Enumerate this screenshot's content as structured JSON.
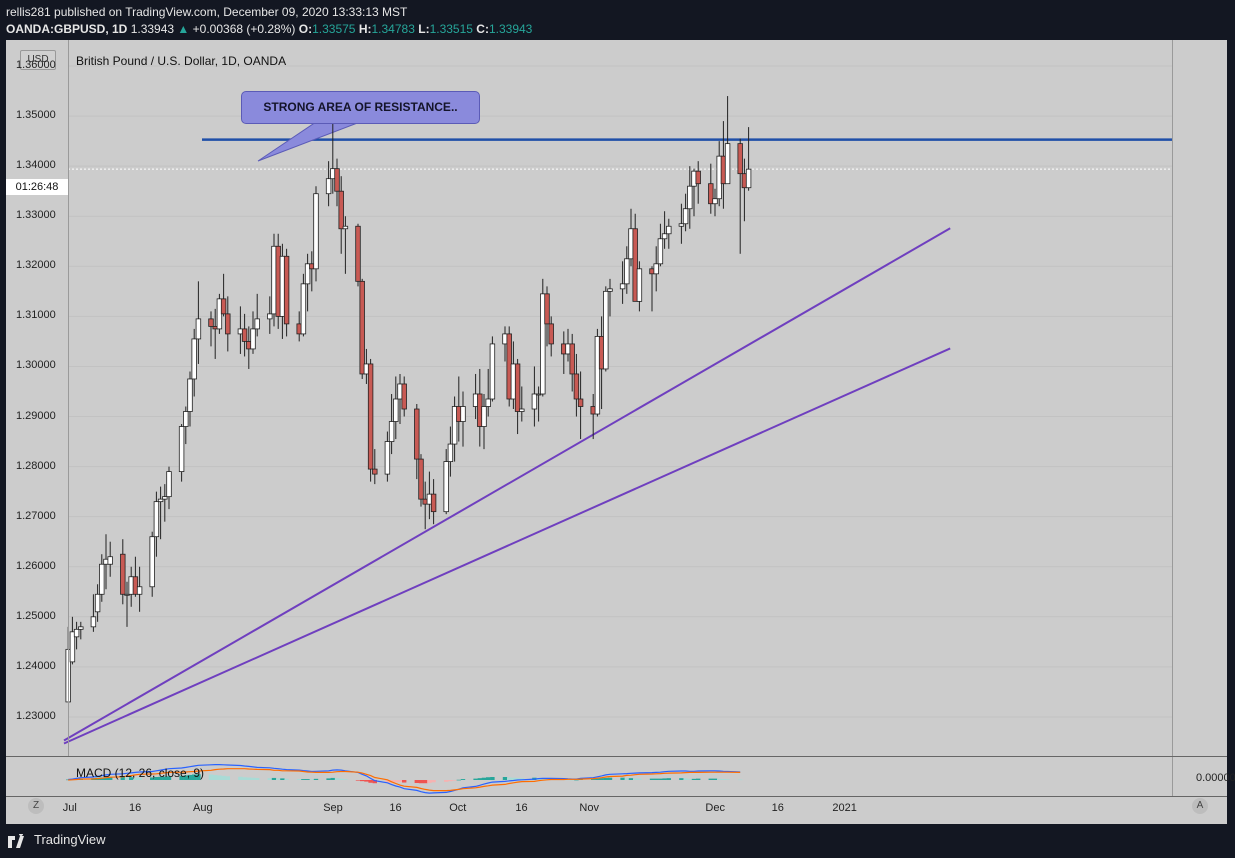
{
  "header": {
    "publisher_line": "rellis281 published on TradingView.com, December 09, 2020 13:33:13 MST",
    "symbol": "OANDA:GBPUSD, 1D",
    "last": "1.33943",
    "change": "+0.00368 (+0.28%)",
    "o_label": "O:",
    "o_value": "1.33575",
    "h_label": "H:",
    "h_value": "1.34783",
    "l_label": "L:",
    "l_value": "1.33515",
    "c_label": "C:",
    "c_value": "1.33943"
  },
  "chart_data": {
    "type": "candlestick",
    "title": "British Pound / U.S. Dollar, 1D, OANDA",
    "currency": "USD",
    "countdown": "01:26:48",
    "ylim": [
      1.223,
      1.364
    ],
    "y_ticks": [
      "1.36000",
      "1.35000",
      "1.34000",
      "1.33000",
      "1.32000",
      "1.31000",
      "1.30000",
      "1.29000",
      "1.28000",
      "1.27000",
      "1.26000",
      "1.25000",
      "1.24000",
      "1.23000"
    ],
    "x_ticks": [
      "Jul",
      "16",
      "Aug",
      "Sep",
      "16",
      "Oct",
      "16",
      "Nov",
      "Dec",
      "16",
      "2021"
    ],
    "annotation": "STRONG AREA OF RESISTANCE..",
    "resistance_level": 1.3453,
    "trendlines": [
      {
        "from": [
          "2020-06-29",
          1.2253
        ],
        "to": [
          "2021-01-26",
          1.3276
        ]
      },
      {
        "from": [
          "2020-06-29",
          1.2247
        ],
        "to": [
          "2021-01-26",
          1.3036
        ]
      }
    ],
    "candles": [
      [
        "2020-06-30",
        1.233,
        1.248,
        1.237,
        1.2435
      ],
      [
        "2020-07-01",
        1.241,
        1.25,
        1.2405,
        1.247
      ],
      [
        "2020-07-02",
        1.246,
        1.249,
        1.2435,
        1.2475
      ],
      [
        "2020-07-03",
        1.2475,
        1.249,
        1.2455,
        1.248
      ],
      [
        "2020-07-06",
        1.248,
        1.2545,
        1.247,
        1.25
      ],
      [
        "2020-07-07",
        1.251,
        1.2565,
        1.249,
        1.2545
      ],
      [
        "2020-07-08",
        1.2545,
        1.2625,
        1.253,
        1.2605
      ],
      [
        "2020-07-09",
        1.2605,
        1.2665,
        1.2555,
        1.2615
      ],
      [
        "2020-07-10",
        1.2605,
        1.265,
        1.258,
        1.262
      ],
      [
        "2020-07-13",
        1.2625,
        1.2655,
        1.2525,
        1.2545
      ],
      [
        "2020-07-14",
        1.2545,
        1.257,
        1.248,
        1.2545
      ],
      [
        "2020-07-15",
        1.2545,
        1.26,
        1.252,
        1.258
      ],
      [
        "2020-07-16",
        1.258,
        1.262,
        1.254,
        1.2545
      ],
      [
        "2020-07-17",
        1.2545,
        1.26,
        1.251,
        1.256
      ],
      [
        "2020-07-20",
        1.256,
        1.267,
        1.254,
        1.266
      ],
      [
        "2020-07-21",
        1.266,
        1.275,
        1.262,
        1.273
      ],
      [
        "2020-07-22",
        1.273,
        1.276,
        1.2655,
        1.2735
      ],
      [
        "2020-07-23",
        1.2735,
        1.2765,
        1.269,
        1.274
      ],
      [
        "2020-07-24",
        1.274,
        1.28,
        1.2715,
        1.279
      ],
      [
        "2020-07-27",
        1.279,
        1.2885,
        1.277,
        1.288
      ],
      [
        "2020-07-28",
        1.288,
        1.292,
        1.2845,
        1.291
      ],
      [
        "2020-07-29",
        1.291,
        1.299,
        1.288,
        1.2975
      ],
      [
        "2020-07-30",
        1.2975,
        1.3075,
        1.294,
        1.3055
      ],
      [
        "2020-07-31",
        1.3055,
        1.317,
        1.3005,
        1.3095
      ],
      [
        "2020-08-03",
        1.3095,
        1.311,
        1.304,
        1.308
      ],
      [
        "2020-08-04",
        1.308,
        1.3115,
        1.3015,
        1.3075
      ],
      [
        "2020-08-05",
        1.3075,
        1.3145,
        1.3065,
        1.3135
      ],
      [
        "2020-08-06",
        1.3135,
        1.3185,
        1.31,
        1.3105
      ],
      [
        "2020-08-07",
        1.3105,
        1.314,
        1.303,
        1.3065
      ],
      [
        "2020-08-10",
        1.3065,
        1.312,
        1.3025,
        1.3075
      ],
      [
        "2020-08-11",
        1.3075,
        1.3105,
        1.302,
        1.305
      ],
      [
        "2020-08-12",
        1.305,
        1.308,
        1.2995,
        1.3035
      ],
      [
        "2020-08-13",
        1.3035,
        1.311,
        1.3025,
        1.3075
      ],
      [
        "2020-08-14",
        1.3075,
        1.3145,
        1.306,
        1.3095
      ],
      [
        "2020-08-17",
        1.3095,
        1.314,
        1.3065,
        1.3105
      ],
      [
        "2020-08-18",
        1.3105,
        1.3265,
        1.308,
        1.324
      ],
      [
        "2020-08-19",
        1.324,
        1.3265,
        1.3075,
        1.31
      ],
      [
        "2020-08-20",
        1.31,
        1.3245,
        1.3055,
        1.322
      ],
      [
        "2020-08-21",
        1.322,
        1.3235,
        1.306,
        1.3085
      ],
      [
        "2020-08-24",
        1.3085,
        1.311,
        1.305,
        1.3065
      ],
      [
        "2020-08-25",
        1.3065,
        1.3185,
        1.306,
        1.3165
      ],
      [
        "2020-08-26",
        1.3165,
        1.3225,
        1.311,
        1.3205
      ],
      [
        "2020-08-27",
        1.3205,
        1.323,
        1.315,
        1.3195
      ],
      [
        "2020-08-28",
        1.3195,
        1.336,
        1.317,
        1.3345
      ],
      [
        "2020-08-31",
        1.3345,
        1.341,
        1.332,
        1.3375
      ],
      [
        "2020-09-01",
        1.3375,
        1.3485,
        1.3345,
        1.3395
      ],
      [
        "2020-09-02",
        1.3395,
        1.3415,
        1.332,
        1.335
      ],
      [
        "2020-09-03",
        1.335,
        1.338,
        1.3225,
        1.3275
      ],
      [
        "2020-09-04",
        1.3275,
        1.33,
        1.3185,
        1.328
      ],
      [
        "2020-09-07",
        1.328,
        1.3285,
        1.316,
        1.317
      ],
      [
        "2020-09-08",
        1.317,
        1.3175,
        1.2975,
        1.2985
      ],
      [
        "2020-09-09",
        1.2985,
        1.3035,
        1.2965,
        1.3005
      ],
      [
        "2020-09-10",
        1.3005,
        1.3015,
        1.277,
        1.2795
      ],
      [
        "2020-09-11",
        1.2795,
        1.2835,
        1.2765,
        1.2785
      ],
      [
        "2020-09-14",
        1.2785,
        1.287,
        1.277,
        1.285
      ],
      [
        "2020-09-15",
        1.285,
        1.2945,
        1.2825,
        1.289
      ],
      [
        "2020-09-16",
        1.289,
        1.298,
        1.2855,
        1.2935
      ],
      [
        "2020-09-17",
        1.2935,
        1.2985,
        1.2885,
        1.2965
      ],
      [
        "2020-09-18",
        1.2965,
        1.298,
        1.29,
        1.2915
      ],
      [
        "2020-09-21",
        1.2915,
        1.2925,
        1.2775,
        1.2815
      ],
      [
        "2020-09-22",
        1.2815,
        1.2825,
        1.272,
        1.2735
      ],
      [
        "2020-09-23",
        1.2735,
        1.277,
        1.2675,
        1.2725
      ],
      [
        "2020-09-24",
        1.2725,
        1.279,
        1.2695,
        1.2745
      ],
      [
        "2020-09-25",
        1.2745,
        1.2775,
        1.2685,
        1.271
      ],
      [
        "2020-09-28",
        1.271,
        1.2835,
        1.2705,
        1.281
      ],
      [
        "2020-09-29",
        1.281,
        1.288,
        1.278,
        1.2845
      ],
      [
        "2020-09-30",
        1.2845,
        1.294,
        1.281,
        1.292
      ],
      [
        "2020-10-01",
        1.292,
        1.298,
        1.285,
        1.289
      ],
      [
        "2020-10-02",
        1.289,
        1.295,
        1.284,
        1.292
      ],
      [
        "2020-10-05",
        1.292,
        1.2985,
        1.2895,
        1.2945
      ],
      [
        "2020-10-06",
        1.2945,
        1.2995,
        1.284,
        1.288
      ],
      [
        "2020-10-07",
        1.288,
        1.2945,
        1.2835,
        1.292
      ],
      [
        "2020-10-08",
        1.292,
        1.2995,
        1.29,
        1.2935
      ],
      [
        "2020-10-09",
        1.2935,
        1.306,
        1.293,
        1.3045
      ],
      [
        "2020-10-12",
        1.3045,
        1.308,
        1.301,
        1.3065
      ],
      [
        "2020-10-13",
        1.3065,
        1.308,
        1.292,
        1.2935
      ],
      [
        "2020-10-14",
        1.2935,
        1.305,
        1.2915,
        1.3005
      ],
      [
        "2020-10-15",
        1.3005,
        1.3015,
        1.2865,
        1.291
      ],
      [
        "2020-10-16",
        1.291,
        1.296,
        1.289,
        1.2915
      ],
      [
        "2020-10-19",
        1.2915,
        1.3,
        1.288,
        1.2945
      ],
      [
        "2020-10-20",
        1.2945,
        1.296,
        1.289,
        1.2945
      ],
      [
        "2020-10-21",
        1.2945,
        1.3175,
        1.294,
        1.3145
      ],
      [
        "2020-10-22",
        1.3145,
        1.316,
        1.304,
        1.3085
      ],
      [
        "2020-10-23",
        1.3085,
        1.31,
        1.302,
        1.3045
      ],
      [
        "2020-10-26",
        1.3045,
        1.307,
        1.2985,
        1.3025
      ],
      [
        "2020-10-27",
        1.3025,
        1.3075,
        1.301,
        1.3045
      ],
      [
        "2020-10-28",
        1.3045,
        1.3065,
        1.295,
        1.2985
      ],
      [
        "2020-10-29",
        1.2985,
        1.3025,
        1.29,
        1.2935
      ],
      [
        "2020-10-30",
        1.2935,
        1.299,
        1.2855,
        1.292
      ],
      [
        "2020-11-02",
        1.292,
        1.2945,
        1.2855,
        1.2905
      ],
      [
        "2020-11-03",
        1.2905,
        1.3075,
        1.29,
        1.306
      ],
      [
        "2020-11-04",
        1.306,
        1.31,
        1.2915,
        1.2995
      ],
      [
        "2020-11-05",
        1.2995,
        1.316,
        1.299,
        1.315
      ],
      [
        "2020-11-06",
        1.315,
        1.3175,
        1.31,
        1.3155
      ],
      [
        "2020-11-09",
        1.3155,
        1.321,
        1.3125,
        1.3165
      ],
      [
        "2020-11-10",
        1.3165,
        1.324,
        1.3145,
        1.3215
      ],
      [
        "2020-11-11",
        1.3215,
        1.3315,
        1.32,
        1.3275
      ],
      [
        "2020-11-12",
        1.3275,
        1.3305,
        1.313,
        1.313
      ],
      [
        "2020-11-13",
        1.313,
        1.321,
        1.311,
        1.3195
      ],
      [
        "2020-11-16",
        1.3195,
        1.32,
        1.311,
        1.3185
      ],
      [
        "2020-11-17",
        1.3185,
        1.324,
        1.315,
        1.3205
      ],
      [
        "2020-11-18",
        1.3205,
        1.3285,
        1.32,
        1.3255
      ],
      [
        "2020-11-19",
        1.3255,
        1.331,
        1.3235,
        1.3265
      ],
      [
        "2020-11-20",
        1.3265,
        1.3295,
        1.3235,
        1.328
      ],
      [
        "2020-11-23",
        1.328,
        1.3325,
        1.3245,
        1.3285
      ],
      [
        "2020-11-24",
        1.3285,
        1.3345,
        1.327,
        1.3315
      ],
      [
        "2020-11-25",
        1.3315,
        1.34,
        1.3275,
        1.336
      ],
      [
        "2020-11-26",
        1.336,
        1.3395,
        1.33,
        1.339
      ],
      [
        "2020-11-27",
        1.339,
        1.341,
        1.3325,
        1.3365
      ],
      [
        "2020-11-30",
        1.3365,
        1.3405,
        1.3305,
        1.3325
      ],
      [
        "2020-12-01",
        1.3325,
        1.3355,
        1.33,
        1.3335
      ],
      [
        "2020-12-02",
        1.3335,
        1.345,
        1.332,
        1.342
      ],
      [
        "2020-12-03",
        1.342,
        1.349,
        1.3315,
        1.3365
      ],
      [
        "2020-12-04",
        1.3365,
        1.354,
        1.3365,
        1.3445
      ],
      [
        "2020-12-07",
        1.3445,
        1.3455,
        1.3225,
        1.3385
      ],
      [
        "2020-12-08",
        1.3385,
        1.3415,
        1.329,
        1.3357
      ],
      [
        "2020-12-09",
        1.3357,
        1.3478,
        1.3351,
        1.3394
      ]
    ],
    "macd": {
      "label": "MACD (12, 26, close, 9)",
      "zero_label": "0.00000",
      "histogram": [
        0.2,
        0.4,
        0.5,
        0.6,
        0.8,
        1.0,
        1.1,
        1.2,
        1.3,
        1.3,
        1.2,
        1.2,
        1.1,
        1.0,
        1.1,
        1.3,
        1.4,
        1.5,
        1.6,
        1.8,
        2.0,
        2.2,
        2.4,
        2.5,
        2.4,
        2.2,
        2.0,
        1.8,
        1.6,
        1.4,
        1.2,
        1.1,
        1.0,
        0.9,
        0.8,
        0.9,
        0.7,
        0.7,
        0.5,
        0.4,
        0.4,
        0.4,
        0.3,
        0.5,
        0.7,
        0.9,
        0.8,
        0.6,
        0.3,
        -0.1,
        -0.5,
        -0.7,
        -1.2,
        -1.4,
        -1.3,
        -1.2,
        -1.1,
        -0.9,
        -1.1,
        -1.3,
        -1.4,
        -1.4,
        -1.3,
        -1.0,
        -0.8,
        -0.5,
        -0.2,
        0.1,
        0.4,
        0.6,
        0.8,
        1.0,
        1.2,
        1.3,
        1.3,
        1.1,
        1.0,
        0.9,
        0.8,
        1.0,
        0.9,
        0.8,
        0.6,
        0.5,
        0.4,
        0.2,
        0.1,
        0.1,
        0.3,
        0.4,
        0.6,
        0.8,
        0.9,
        1.0,
        1.0,
        0.8,
        0.8,
        0.7,
        0.6,
        0.6,
        0.6,
        0.6,
        0.7,
        0.8,
        0.8,
        0.7,
        0.5,
        0.5,
        0.6,
        0.6,
        0.6,
        0.5,
        0.4,
        0.3,
        0.2
      ],
      "macd_line": [
        0.2,
        0.4,
        0.7,
        1.0,
        1.3,
        1.6,
        1.9,
        2.2,
        2.5,
        2.7,
        2.9,
        3.1,
        3.3,
        3.5,
        3.7,
        4.0,
        4.3,
        4.6,
        4.9,
        5.2,
        5.5,
        5.8,
        6.1,
        6.4,
        6.6,
        6.7,
        6.7,
        6.6,
        6.5,
        6.3,
        6.1,
        5.9,
        5.7,
        5.5,
        5.3,
        5.1,
        4.9,
        4.7,
        4.5,
        4.3,
        4.1,
        3.9,
        3.7,
        3.8,
        4.0,
        4.3,
        4.4,
        4.3,
        4.0,
        3.3,
        2.5,
        1.8,
        0.7,
        -0.3,
        -1.2,
        -2.0,
        -2.6,
        -3.1,
        -3.8,
        -4.5,
        -5.1,
        -5.5,
        -5.7,
        -5.6,
        -5.4,
        -5.0,
        -4.5,
        -4.0,
        -3.4,
        -2.8,
        -2.3,
        -1.8,
        -1.3,
        -0.9,
        -0.6,
        -0.4,
        -0.2,
        0.0,
        0.1,
        0.4,
        0.6,
        0.7,
        0.7,
        0.7,
        0.6,
        0.5,
        0.4,
        0.4,
        0.7,
        1.0,
        1.4,
        1.8,
        2.2,
        2.5,
        2.7,
        2.8,
        2.9,
        3.0,
        3.1,
        3.2,
        3.3,
        3.4,
        3.6,
        3.8,
        3.9,
        3.9,
        3.8,
        3.8,
        3.9,
        4.0,
        4.0,
        3.9,
        3.8,
        3.7,
        3.5
      ],
      "signal_line": [
        0.0,
        0.1,
        0.2,
        0.4,
        0.5,
        0.6,
        0.8,
        1.0,
        1.2,
        1.4,
        1.7,
        1.9,
        2.2,
        2.5,
        2.6,
        2.7,
        2.9,
        3.1,
        3.3,
        3.4,
        3.5,
        3.6,
        3.7,
        3.9,
        4.2,
        4.5,
        4.7,
        4.8,
        4.9,
        4.9,
        4.9,
        4.8,
        4.7,
        4.6,
        4.5,
        4.2,
        4.2,
        4.0,
        4.0,
        3.9,
        3.7,
        3.5,
        3.4,
        3.3,
        3.3,
        3.4,
        3.6,
        3.7,
        3.7,
        3.4,
        3.0,
        2.5,
        1.9,
        1.1,
        0.1,
        -0.8,
        -1.5,
        -2.2,
        -2.7,
        -3.2,
        -3.7,
        -4.1,
        -4.4,
        -4.6,
        -4.6,
        -4.5,
        -4.3,
        -4.1,
        -3.8,
        -3.4,
        -3.1,
        -2.8,
        -2.5,
        -2.2,
        -1.9,
        -1.5,
        -1.2,
        -0.9,
        -0.7,
        -0.6,
        -0.3,
        -0.1,
        0.1,
        0.2,
        0.2,
        0.3,
        0.3,
        0.3,
        0.4,
        0.6,
        0.8,
        1.0,
        1.3,
        1.5,
        1.7,
        2.0,
        2.1,
        2.3,
        2.5,
        2.6,
        2.7,
        2.8,
        2.9,
        3.0,
        3.1,
        3.2,
        3.3,
        3.3,
        3.3,
        3.4,
        3.4,
        3.4,
        3.4,
        3.4,
        3.3
      ]
    }
  },
  "footer": {
    "brand": "TradingView"
  },
  "bottom_left_button": "Z",
  "bottom_right_button": "A"
}
